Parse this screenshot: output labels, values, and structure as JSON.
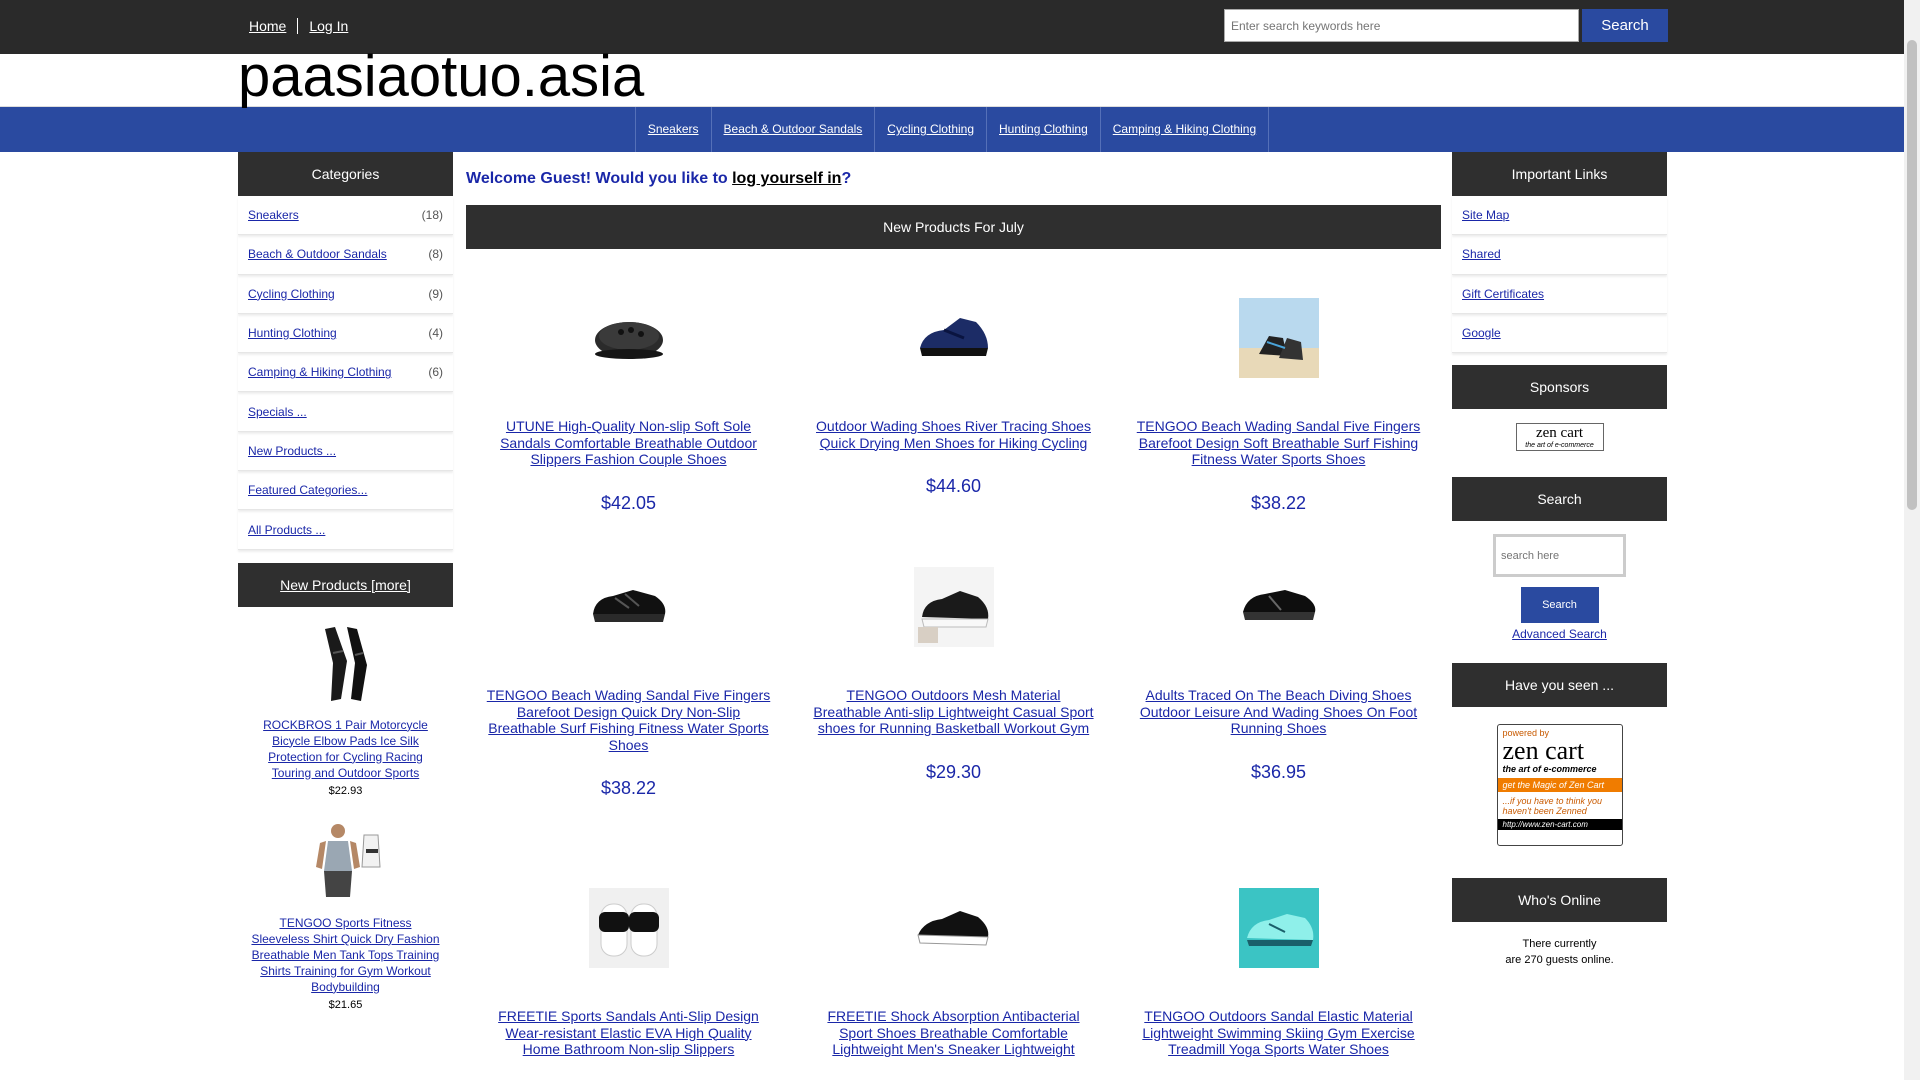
{
  "header": {
    "nav": [
      {
        "label": "Home"
      },
      {
        "label": "Log In"
      }
    ],
    "search_placeholder": "Enter search keywords here",
    "search_button": "Search"
  },
  "logo": "paasiaotuo.asia",
  "catbar": [
    "Sneakers",
    "Beach & Outdoor Sandals",
    "Cycling Clothing",
    "Hunting Clothing",
    "Camping & Hiking Clothing"
  ],
  "left": {
    "categories_title": "Categories",
    "categories": [
      {
        "label": "Sneakers",
        "count": "(18)"
      },
      {
        "label": "Beach & Outdoor Sandals",
        "count": "(8)"
      },
      {
        "label": "Cycling Clothing",
        "count": "(9)"
      },
      {
        "label": "Hunting Clothing",
        "count": "(4)"
      },
      {
        "label": "Camping & Hiking Clothing",
        "count": "(6)"
      },
      {
        "label": "Specials ...",
        "count": ""
      },
      {
        "label": "New Products ...",
        "count": ""
      },
      {
        "label": "Featured Categories...",
        "count": ""
      },
      {
        "label": "All Products ...",
        "count": ""
      }
    ],
    "new_products_title": "New Products  [more]",
    "new_products": [
      {
        "name": "ROCKBROS 1 Pair Motorcycle Bicycle Elbow Pads Ice Silk Protection for Cycling Racing Touring and Outdoor Sports",
        "price": "$22.93"
      },
      {
        "name": "TENGOO Sports Fitness Sleeveless Shirt Quick Dry Fashion Breathable Men Tank Tops Training Shirts Training for Gym Workout Bodybuilding",
        "price": "$21.65"
      }
    ]
  },
  "main": {
    "welcome_prefix": "Welcome Guest! Would you like to ",
    "welcome_link": "log yourself in",
    "welcome_suffix": "?",
    "section_title": "New Products For July",
    "products": [
      {
        "name": "UTUNE High-Quality Non-slip Soft Sole Sandals Comfortable Breathable Outdoor Slippers Fashion Couple Shoes",
        "price": "$42.05"
      },
      {
        "name": "Outdoor Wading Shoes River Tracing Shoes Quick Drying Men Shoes for Hiking Cycling",
        "price": "$44.60"
      },
      {
        "name": "TENGOO Beach Wading Sandal Five Fingers Barefoot Design Soft Breathable Surf Fishing Fitness Water Sports Shoes",
        "price": "$38.22"
      },
      {
        "name": "TENGOO Beach Wading Sandal Five Fingers Barefoot Design Quick Dry Non-Slip Breathable Surf Fishing Fitness Water Sports Shoes",
        "price": "$38.22"
      },
      {
        "name": "TENGOO Outdoors Mesh Material Breathable Anti-slip Lightweight Casual Sport shoes for Running Basketball Workout Gym",
        "price": "$29.30"
      },
      {
        "name": "Adults Traced On The Beach Diving Shoes Outdoor Leisure And Wading Shoes On Foot Running Shoes",
        "price": "$36.95"
      },
      {
        "name": "FREETIE Sports Sandals Anti-Slip Design Wear-resistant Elastic EVA High Quality Home Bathroom Non-slip Slippers",
        "price": ""
      },
      {
        "name": "FREETIE Shock Absorption Antibacterial Sport Shoes Breathable Comfortable Lightweight Men's Sneaker Lightweight",
        "price": ""
      },
      {
        "name": "TENGOO Outdoors Sandal Elastic Material Lightweight Swimming Skiing Gym Exercise Treadmill Yoga Sports Water Shoes",
        "price": ""
      }
    ]
  },
  "right": {
    "links_title": "Important Links",
    "links": [
      "Site Map",
      "Shared",
      "Gift Certificates",
      "Google"
    ],
    "sponsors_title": "Sponsors",
    "sponsor_logo_text": "zen cart",
    "sponsor_logo_sub": "the art of e-commerce",
    "search_title": "Search",
    "search_placeholder": "search here",
    "search_button": "Search",
    "advanced_search": "Advanced Search",
    "have_you_seen_title": "Have you seen ...",
    "banner": {
      "powered": "powered by",
      "brand": "zen cart",
      "tagline": "the art of e-commerce",
      "bar": "get the Magic of Zen Cart",
      "note": "...if you have to think you haven't been Zenned",
      "url": "http://www.zen-cart.com"
    },
    "whos_online_title": "Who's Online",
    "online_line1": "There currently",
    "online_line2": "are 270 guests online."
  }
}
